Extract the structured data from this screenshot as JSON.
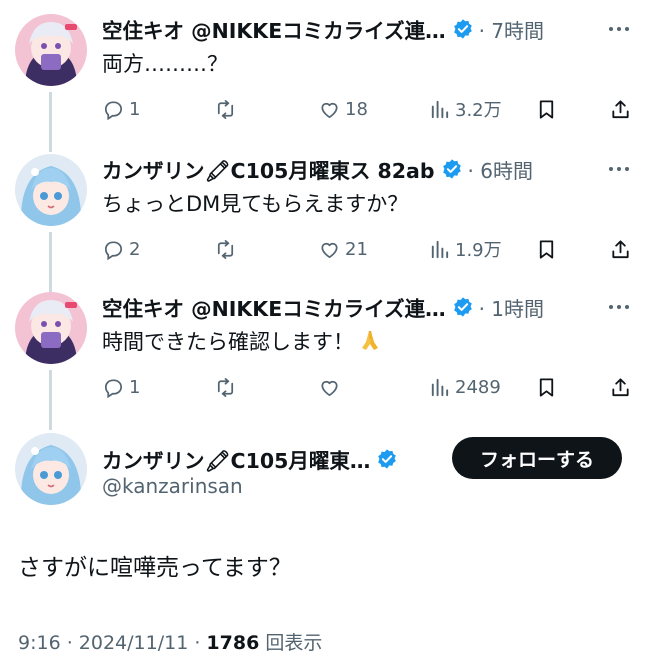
{
  "thread": [
    {
      "author": "空住キオ @NIKKEコミカライズ連…",
      "meta": "· 7時間",
      "text": "両方………？",
      "avatar": "kio-avatar",
      "emoji": "",
      "actions": {
        "replies": "1",
        "retweets": "",
        "likes": "18",
        "views": "3.2万"
      }
    },
    {
      "author": "カンザリン🖍C105月曜東ス 82ab",
      "meta": "· 6時間",
      "text": "ちょっとDM見てもらえますか？",
      "avatar": "kanzarin-avatar",
      "emoji": "",
      "actions": {
        "replies": "2",
        "retweets": "",
        "likes": "21",
        "views": "1.9万"
      }
    },
    {
      "author": "空住キオ @NIKKEコミカライズ連…",
      "meta": "· 1時間",
      "text": "時間できたら確認します！",
      "avatar": "kio-avatar",
      "emoji": "folded-hands",
      "actions": {
        "replies": "1",
        "retweets": "",
        "likes": "",
        "views": "2489"
      }
    }
  ],
  "main_tweet": {
    "author": "カンザリン🖍C105月曜東…",
    "handle": "@kanzarinsan",
    "follow_label": "フォローする",
    "text": "さすがに喧嘩売ってます？",
    "time": "9:16 · 2024/11/11 · ",
    "view_count": "1786",
    "view_suffix": " 回表示"
  },
  "icons": [
    "reply-icon",
    "retweet-icon",
    "like-icon",
    "views-icon",
    "bookmark-icon",
    "share-icon",
    "verified-badge-icon",
    "more-icon"
  ],
  "colors": {
    "verified": "#1d9bf0",
    "muted": "#536471",
    "text": "#0f1419",
    "thread_line": "#cfd9de",
    "follow_bg": "#0f1419"
  }
}
